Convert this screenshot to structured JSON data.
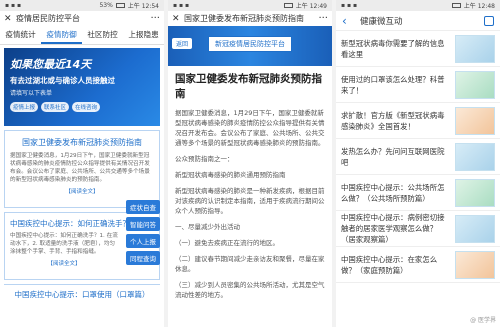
{
  "phone1": {
    "status_time": "上午 12:54",
    "status_sig": "53%",
    "title": "疫情居民防控平台",
    "nav": [
      "疫情统计",
      "疫情防御",
      "社区防控",
      "上报隐患"
    ],
    "banner": {
      "line1": "如果您最近14天",
      "line2": "有去过湖北或与确诊人员接触过",
      "line3": "请填写以下表单",
      "pills": [
        "疫情上报",
        "联系社区",
        "在线咨询"
      ]
    },
    "card1": {
      "title": "国家卫健委发布新冠肺炎预防指南",
      "body": "据国家卫健委消息，1月29日下午，国家卫健委就新型冠状病毒感染的肺炎疫情防控公众指导提供有关情况召开发布会。会议公布了家庭、公共场所、公共交通等多个场景的新型冠状病毒感染肺炎的预防指南。",
      "more": "【阅读全文】"
    },
    "card2": {
      "title": "中国疾控中心提示：如何正确洗手？",
      "body": "中国疾控中心提示：如何正确洗手？1. 在流动水下，2. 取适量的洗手液（肥皂），均匀涂抹整个手掌、手背、手指和指缝。",
      "more": "【阅读全文】"
    },
    "card3": {
      "title": "中国疾控中心提示：口罩使用（口罩篇）"
    },
    "floats": [
      "症状自查",
      "智能问答",
      "个人上报",
      "同程查询"
    ]
  },
  "phone2": {
    "status_time": "上午 12:49",
    "title": "国家卫健委发布新冠肺炎预防指南",
    "chip": "新冠疫情居民防控平台",
    "back": "返回",
    "article_title": "国家卫健委发布新冠肺炎预防指南",
    "paras": [
      "据国家卫健委消息，1月29日下午，国家卫健委就新型冠状病毒感染的肺炎疫情防控公众指导提供有关情况召开发布会。会议公布了家庭、公共场所、公共交通等多个场景的新型冠状病毒感染肺炎的预防指南。",
      "公众预防指南之一：",
      "新型冠状病毒感染的肺炎通用预防指南",
      "新型冠状病毒感染的肺炎是一种新发疾病，根据目前对该疾病的认识制定本指南，适用于疾病流行期间公众个人预防指导。",
      "一、尽量减少外出活动",
      "（一）避免去疾病正在流行的地区。",
      "（二）建议春节期间减少走亲访友和聚餐，尽量在家休息。",
      "（三）减少到人员密集的公共场所活动，尤其是空气流动性差的地方。"
    ]
  },
  "phone3": {
    "status_time": "上午 12:48",
    "title": "健康微互动",
    "items": [
      "新型冠状病毒你需要了解的信息看这里",
      "使用过的口罩该怎么处理？科普来了！",
      "求扩散！官方版《新型冠状病毒感染肺炎》全国首发！",
      "发热怎么办？先问问互联网医院吧",
      "中国疾控中心提示：公共场所怎么做？（公共场所预防篇）",
      "中国疾控中心提示：病例密切接触者的居家医学观察怎么做？（居家观察篇）",
      "中国疾控中心提示：在家怎么做？（家庭预防篇）"
    ],
    "watermark": "@ 医学界"
  }
}
